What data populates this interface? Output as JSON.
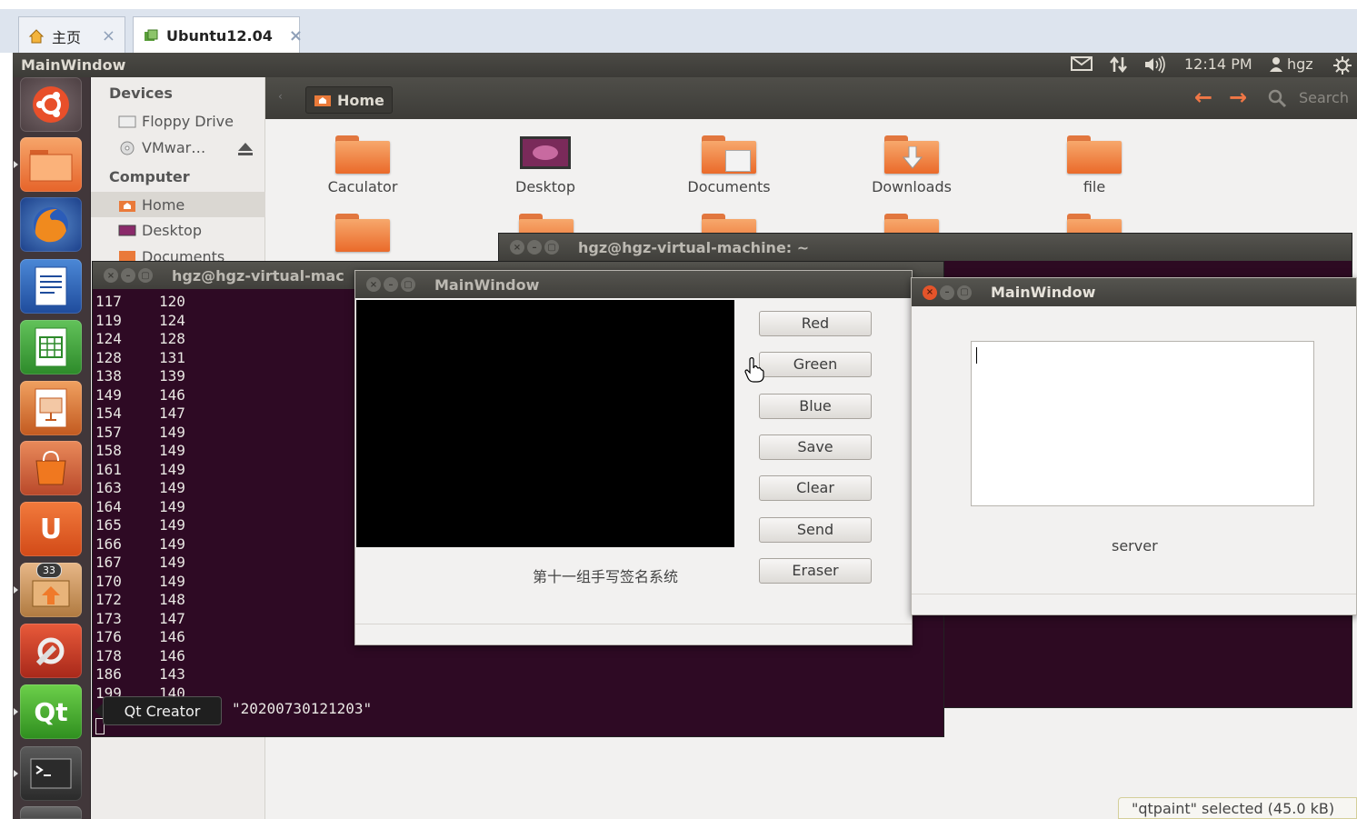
{
  "vm_tabs": [
    {
      "label": "主页",
      "close": "×"
    },
    {
      "label": "Ubuntu12.04",
      "close": "×"
    }
  ],
  "panel": {
    "title": "MainWindow",
    "time": "12:14 PM",
    "user": "hgz",
    "icons": [
      "mail-icon",
      "network-icon",
      "volume-icon",
      "user-icon",
      "session-gear-icon"
    ]
  },
  "launcher": {
    "items": [
      "dash-home",
      "files",
      "firefox",
      "writer",
      "calc",
      "impress",
      "software-center",
      "ubuntu-one",
      "update-manager",
      "system-settings",
      "qt-creator",
      "terminal",
      "workspace"
    ],
    "badge": "33"
  },
  "sidebar": {
    "devices_header": "Devices",
    "computer_header": "Computer",
    "floppy": "Floppy Drive",
    "vmware": "VMwar…",
    "home": "Home",
    "desktop": "Desktop",
    "documents": "Documents"
  },
  "toolbar": {
    "path": "Home",
    "search": "Search"
  },
  "files": [
    {
      "name": "Caculator"
    },
    {
      "name": "Desktop"
    },
    {
      "name": "Documents"
    },
    {
      "name": "Downloads"
    },
    {
      "name": "file"
    }
  ],
  "term_back": {
    "title": "hgz@hgz-virtual-machine: ~"
  },
  "term_main": {
    "title": "hgz@hgz-virtual-mac",
    "rows": [
      [
        "117",
        "120"
      ],
      [
        "119",
        "124"
      ],
      [
        "124",
        "128"
      ],
      [
        "128",
        "131"
      ],
      [
        "138",
        "139"
      ],
      [
        "149",
        "146"
      ],
      [
        "154",
        "147"
      ],
      [
        "157",
        "149"
      ],
      [
        "158",
        "149"
      ],
      [
        "161",
        "149"
      ],
      [
        "163",
        "149"
      ],
      [
        "164",
        "149"
      ],
      [
        "165",
        "149"
      ],
      [
        "166",
        "149"
      ],
      [
        "167",
        "149"
      ],
      [
        "170",
        "149"
      ],
      [
        "172",
        "148"
      ],
      [
        "173",
        "147"
      ],
      [
        "176",
        "146"
      ],
      [
        "178",
        "146"
      ],
      [
        "186",
        "143"
      ],
      [
        "199",
        "140"
      ]
    ],
    "last_line": "\"20200730121203\""
  },
  "qt_window": {
    "title": "MainWindow",
    "buttons": [
      "Red",
      "Green",
      "Blue",
      "Save",
      "Clear",
      "Send",
      "Eraser"
    ],
    "label": "第十一组手写签名系统"
  },
  "server_window": {
    "title": "MainWindow",
    "label": "server"
  },
  "tooltip": "Qt Creator",
  "nautilus_status": "\"qtpaint\" selected (45.0 kB)",
  "colors": {
    "ubuntu_orange": "#e5542a",
    "terminal_bg": "#2e0a24",
    "panel_bg": "#3c3b37"
  }
}
